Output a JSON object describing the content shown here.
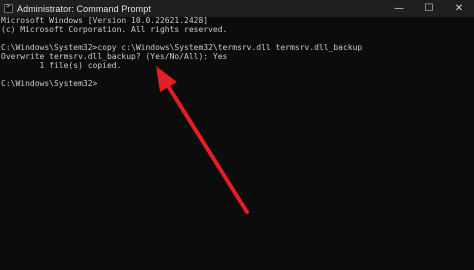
{
  "window": {
    "title": "Administrator: Command Prompt",
    "controls": {
      "minimize": "—",
      "maximize": "☐",
      "close": "✕"
    }
  },
  "console": {
    "lines": [
      "Microsoft Windows [Version 10.0.22621.2428]",
      "(c) Microsoft Corporation. All rights reserved.",
      "C:\\Windows\\System32>copy c:\\Windows\\System32\\termsrv.dll termsrv.dll_backup",
      "Overwrite termsrv.dll_backup? (Yes/No/All): Yes",
      "        1 file(s) copied.",
      "C:\\Windows\\System32>"
    ]
  },
  "annotation": {
    "arrow_color": "#e31e24",
    "arrow_icon": "red-arrow"
  }
}
